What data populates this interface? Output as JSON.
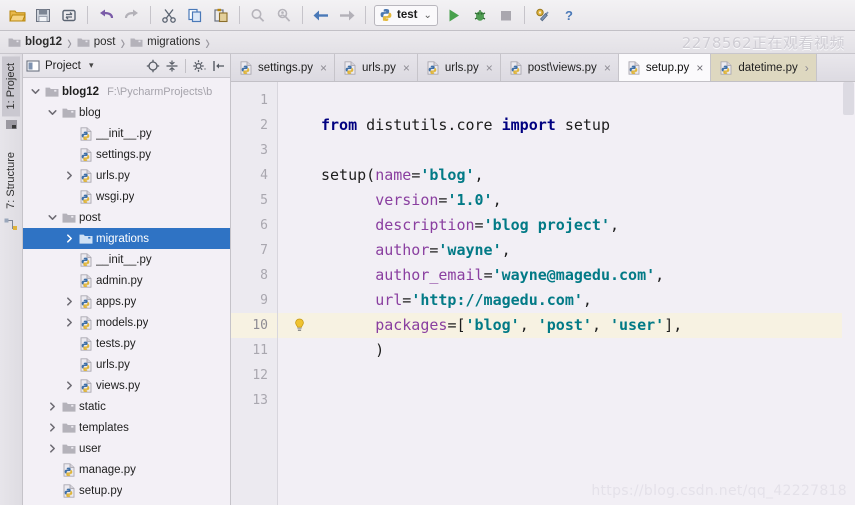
{
  "toolbar": {
    "buttons": [
      {
        "name": "open-folder-icon",
        "title": "Open"
      },
      {
        "name": "save-all-icon",
        "title": "Save All"
      },
      {
        "name": "sync-icon",
        "title": "Synchronize"
      },
      {
        "name": "undo-icon",
        "title": "Undo"
      },
      {
        "name": "redo-icon",
        "title": "Redo"
      },
      {
        "name": "cut-icon",
        "title": "Cut"
      },
      {
        "name": "copy-icon",
        "title": "Copy"
      },
      {
        "name": "paste-icon",
        "title": "Paste"
      },
      {
        "name": "find-icon",
        "title": "Find"
      },
      {
        "name": "find-usages-icon",
        "title": "Find Usages"
      },
      {
        "name": "back-icon",
        "title": "Back"
      },
      {
        "name": "forward-icon",
        "title": "Forward"
      },
      {
        "name": "run-icon",
        "title": "Run"
      },
      {
        "name": "debug-icon",
        "title": "Debug"
      },
      {
        "name": "stop-icon",
        "title": "Stop"
      },
      {
        "name": "settings-wrench-icon",
        "title": "Settings"
      },
      {
        "name": "help-icon",
        "title": "Help"
      }
    ],
    "run_config": "test",
    "run_config_chevron": "⌄"
  },
  "breadcrumb": {
    "items": [
      "blog12",
      "post",
      "migrations"
    ],
    "separator": "›"
  },
  "watermark_top": "2278562正在观看视频",
  "watermark_bottom": "https://blog.csdn.net/qq_42227818",
  "tool_tabs": [
    {
      "label": "1: Project",
      "active": true
    },
    {
      "label": "7: Structure",
      "active": false
    }
  ],
  "project_panel": {
    "title": "Project",
    "title_chevron": "▾",
    "buttons": [
      {
        "name": "locate-target-icon"
      },
      {
        "name": "collapse-all-icon"
      },
      {
        "name": "gear-icon"
      },
      {
        "name": "hide-panel-icon"
      }
    ],
    "tree": [
      {
        "label": "blog12",
        "path": "F:\\PycharmProjects\\b",
        "indent": 0,
        "twist": "down",
        "icon": "folder",
        "bold": true,
        "selected": false
      },
      {
        "label": "blog",
        "path": "",
        "indent": 1,
        "twist": "down",
        "icon": "folder",
        "bold": false,
        "selected": false
      },
      {
        "label": "__init__.py",
        "path": "",
        "indent": 2,
        "twist": "none",
        "icon": "python",
        "bold": false,
        "selected": false
      },
      {
        "label": "settings.py",
        "path": "",
        "indent": 2,
        "twist": "none",
        "icon": "python",
        "bold": false,
        "selected": false
      },
      {
        "label": "urls.py",
        "path": "",
        "indent": 2,
        "twist": "right",
        "icon": "python",
        "bold": false,
        "selected": false
      },
      {
        "label": "wsgi.py",
        "path": "",
        "indent": 2,
        "twist": "none",
        "icon": "python",
        "bold": false,
        "selected": false
      },
      {
        "label": "post",
        "path": "",
        "indent": 1,
        "twist": "down",
        "icon": "folder",
        "bold": false,
        "selected": false
      },
      {
        "label": "migrations",
        "path": "",
        "indent": 2,
        "twist": "right",
        "icon": "folder",
        "bold": false,
        "selected": true
      },
      {
        "label": "__init__.py",
        "path": "",
        "indent": 2,
        "twist": "none",
        "icon": "python",
        "bold": false,
        "selected": false
      },
      {
        "label": "admin.py",
        "path": "",
        "indent": 2,
        "twist": "none",
        "icon": "python",
        "bold": false,
        "selected": false
      },
      {
        "label": "apps.py",
        "path": "",
        "indent": 2,
        "twist": "right",
        "icon": "python",
        "bold": false,
        "selected": false
      },
      {
        "label": "models.py",
        "path": "",
        "indent": 2,
        "twist": "right",
        "icon": "python",
        "bold": false,
        "selected": false
      },
      {
        "label": "tests.py",
        "path": "",
        "indent": 2,
        "twist": "none",
        "icon": "python",
        "bold": false,
        "selected": false
      },
      {
        "label": "urls.py",
        "path": "",
        "indent": 2,
        "twist": "none",
        "icon": "python",
        "bold": false,
        "selected": false
      },
      {
        "label": "views.py",
        "path": "",
        "indent": 2,
        "twist": "right",
        "icon": "python",
        "bold": false,
        "selected": false
      },
      {
        "label": "static",
        "path": "",
        "indent": 1,
        "twist": "right",
        "icon": "folder",
        "bold": false,
        "selected": false
      },
      {
        "label": "templates",
        "path": "",
        "indent": 1,
        "twist": "right",
        "icon": "folder",
        "bold": false,
        "selected": false
      },
      {
        "label": "user",
        "path": "",
        "indent": 1,
        "twist": "right",
        "icon": "folder",
        "bold": false,
        "selected": false
      },
      {
        "label": "manage.py",
        "path": "",
        "indent": 1,
        "twist": "none",
        "icon": "python",
        "bold": false,
        "selected": false
      },
      {
        "label": "setup.py",
        "path": "",
        "indent": 1,
        "twist": "none",
        "icon": "python",
        "bold": false,
        "selected": false
      }
    ]
  },
  "editor_tabs": [
    {
      "label": "settings.py",
      "active": false,
      "style": "normal",
      "close": "×"
    },
    {
      "label": "urls.py",
      "active": false,
      "style": "normal",
      "close": "×"
    },
    {
      "label": "urls.py",
      "active": false,
      "style": "normal",
      "close": "×"
    },
    {
      "label": "post\\views.py",
      "active": false,
      "style": "normal",
      "close": "×"
    },
    {
      "label": "setup.py",
      "active": true,
      "style": "normal",
      "close": "×"
    },
    {
      "label": "datetime.py",
      "active": false,
      "style": "khaki",
      "close": "›"
    }
  ],
  "editor": {
    "line_numbers": [
      "1",
      "2",
      "3",
      "4",
      "5",
      "6",
      "7",
      "8",
      "9",
      "10",
      "11",
      "12",
      "13"
    ],
    "current_line": 10,
    "intention_icon": "lightbulb-icon",
    "lines": [
      {
        "n": 1,
        "tokens": []
      },
      {
        "n": 2,
        "tokens": [
          {
            "t": "from",
            "c": "k"
          },
          {
            "t": " ",
            "c": "p"
          },
          {
            "t": "distutils.core",
            "c": "p"
          },
          {
            "t": " ",
            "c": "p"
          },
          {
            "t": "import",
            "c": "k"
          },
          {
            "t": " ",
            "c": "p"
          },
          {
            "t": "setup",
            "c": "p"
          }
        ]
      },
      {
        "n": 3,
        "tokens": []
      },
      {
        "n": 4,
        "tokens": [
          {
            "t": "setup(",
            "c": "p"
          },
          {
            "t": "name",
            "c": "kw"
          },
          {
            "t": "=",
            "c": "p"
          },
          {
            "t": "'blog'",
            "c": "s"
          },
          {
            "t": ",",
            "c": "p"
          }
        ]
      },
      {
        "n": 5,
        "tokens": [
          {
            "t": "      ",
            "c": "p"
          },
          {
            "t": "version",
            "c": "kw"
          },
          {
            "t": "=",
            "c": "p"
          },
          {
            "t": "'1.0'",
            "c": "s"
          },
          {
            "t": ",",
            "c": "p"
          }
        ]
      },
      {
        "n": 6,
        "tokens": [
          {
            "t": "      ",
            "c": "p"
          },
          {
            "t": "description",
            "c": "kw"
          },
          {
            "t": "=",
            "c": "p"
          },
          {
            "t": "'blog project'",
            "c": "s"
          },
          {
            "t": ",",
            "c": "p"
          }
        ]
      },
      {
        "n": 7,
        "tokens": [
          {
            "t": "      ",
            "c": "p"
          },
          {
            "t": "author",
            "c": "kw"
          },
          {
            "t": "=",
            "c": "p"
          },
          {
            "t": "'wayne'",
            "c": "s"
          },
          {
            "t": ",",
            "c": "p"
          }
        ]
      },
      {
        "n": 8,
        "tokens": [
          {
            "t": "      ",
            "c": "p"
          },
          {
            "t": "author_email",
            "c": "kw"
          },
          {
            "t": "=",
            "c": "p"
          },
          {
            "t": "'wayne@magedu.com'",
            "c": "s"
          },
          {
            "t": ",",
            "c": "p"
          }
        ]
      },
      {
        "n": 9,
        "tokens": [
          {
            "t": "      ",
            "c": "p"
          },
          {
            "t": "url",
            "c": "kw"
          },
          {
            "t": "=",
            "c": "p"
          },
          {
            "t": "'http://magedu.com'",
            "c": "s"
          },
          {
            "t": ",",
            "c": "p"
          }
        ]
      },
      {
        "n": 10,
        "tokens": [
          {
            "t": "      ",
            "c": "p"
          },
          {
            "t": "packages",
            "c": "kw"
          },
          {
            "t": "=[",
            "c": "p"
          },
          {
            "t": "'blog'",
            "c": "s"
          },
          {
            "t": ", ",
            "c": "p"
          },
          {
            "t": "'post'",
            "c": "s"
          },
          {
            "t": ", ",
            "c": "p"
          },
          {
            "t": "'user'",
            "c": "s"
          },
          {
            "t": "],",
            "c": "p"
          }
        ]
      },
      {
        "n": 11,
        "tokens": [
          {
            "t": "      )",
            "c": "p"
          }
        ]
      },
      {
        "n": 12,
        "tokens": []
      },
      {
        "n": 13,
        "tokens": []
      }
    ]
  },
  "colors": {
    "selection_blue": "#2f73c4",
    "keyword": "#000080",
    "kwarg": "#8a3fa0",
    "string": "#027a86",
    "current_line_bg": "#f7f2e2",
    "editor_bg": "#f2eff5",
    "khaki_tab": "#ded8c0"
  }
}
